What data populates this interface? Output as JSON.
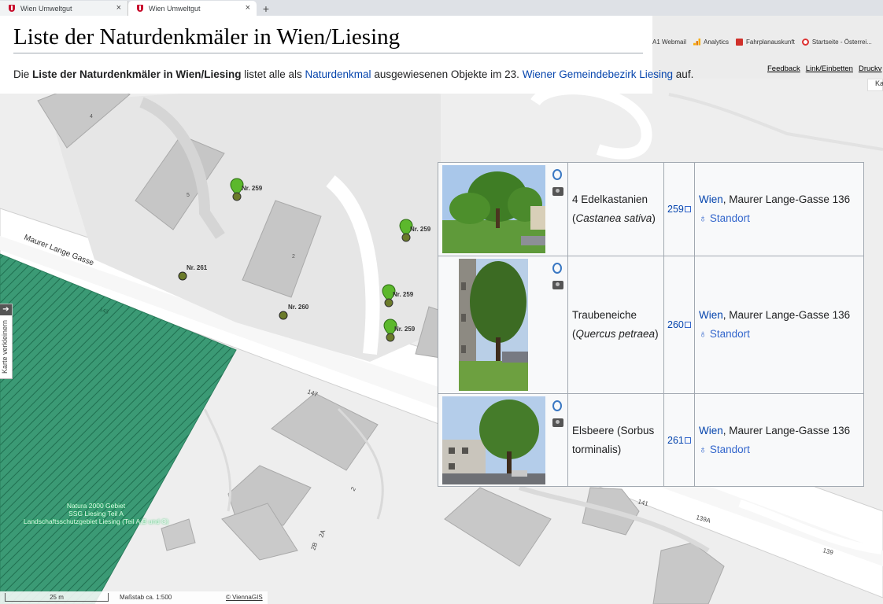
{
  "browser": {
    "tabs": [
      {
        "title": "Wien Umweltgut",
        "active": false
      },
      {
        "title": "Wien Umweltgut",
        "active": true
      }
    ],
    "new_tab": "+",
    "bookmarks": [
      {
        "label": "A1 Webmail",
        "icon": "none"
      },
      {
        "label": "Analytics",
        "icon": "analytics-icon"
      },
      {
        "label": "Fahrplanauskunft",
        "icon": "fahrplan-icon"
      },
      {
        "label": "Startseite - Österrei...",
        "icon": "start-icon"
      }
    ]
  },
  "page": {
    "title": "Liste der Naturdenkmäler in Wien/Liesing",
    "intro": {
      "pre": "Die ",
      "bold": "Liste der Naturdenkmäler in Wien/Liesing",
      "mid1": " listet alle als ",
      "link1": "Naturdenkmal",
      "mid2": " ausgewiesenen Objekte im 23. ",
      "link2": "Wiener Gemeindebezirk",
      "mid3": " ",
      "link3": "Liesing",
      "post": " auf."
    },
    "links": {
      "feedback": "Feedback",
      "embed": "Link/Einbetten",
      "print": "Druckv"
    },
    "karte_label": "Ka"
  },
  "map": {
    "street": "Maurer Lange Gasse",
    "side_tab": "Karte verkleinern",
    "zone_label_1": "Natura 2000 Gebiet",
    "zone_label_2": "Landschaftsschutzgebiet Liesing (Teil A,B und C)",
    "zone_label_3": "SSG Liesing Teil A",
    "house_numbers": [
      "147",
      "2",
      "2B",
      "2A",
      "141",
      "139A",
      "139",
      "5",
      "2",
      "4",
      "143"
    ],
    "scale_bar": "25 m",
    "scale_text": "Maßstab ca. 1:500",
    "copyright": "© ViennaGIS",
    "markers": [
      {
        "label": "Nr. 259",
        "type": "pin"
      },
      {
        "label": "Nr. 259",
        "type": "pin"
      },
      {
        "label": "Nr. 259",
        "type": "pin"
      },
      {
        "label": "Nr. 259",
        "type": "pin"
      },
      {
        "label": "Nr. 261",
        "type": "dot"
      },
      {
        "label": "Nr. 260",
        "type": "dot"
      }
    ]
  },
  "table": {
    "rows": [
      {
        "name": "4 Edelkastanien",
        "latin": "Castanea sativa",
        "nr": "259",
        "city": "Wien",
        "address": ", Maurer Lange-Gasse 136",
        "standort": "Standort"
      },
      {
        "name": "Traubeneiche",
        "latin": "Quercus petraea",
        "nr": "260",
        "city": "Wien",
        "address": ", Maurer Lange-Gasse 136",
        "standort": "Standort"
      },
      {
        "name": "Elsbeere (Sorbus",
        "latin": "torminalis",
        "nr": "261",
        "city": "Wien",
        "address": ", Maurer Lange-Gasse 136",
        "standort": "Standort"
      }
    ]
  },
  "colors": {
    "link": "#0645ad",
    "marker": "#5cb82c",
    "zone": "#3b9a75",
    "title_border": "#a2a9b1"
  }
}
